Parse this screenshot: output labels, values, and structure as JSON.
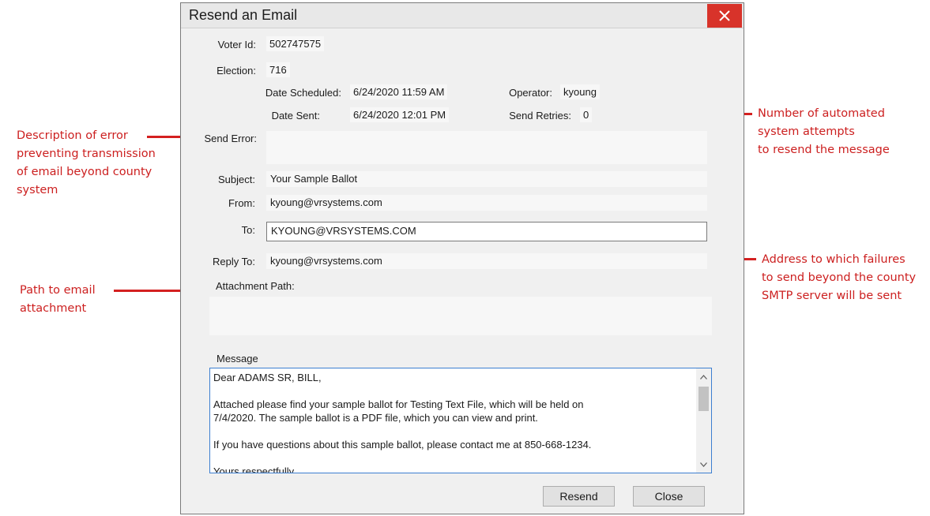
{
  "window": {
    "title": "Resend an Email"
  },
  "labels": {
    "voter_id": "Voter Id:",
    "election": "Election:",
    "date_scheduled": "Date Scheduled:",
    "operator": "Operator:",
    "date_sent": "Date Sent:",
    "send_retries": "Send Retries:",
    "send_error": "Send Error:",
    "subject": "Subject:",
    "from": "From:",
    "to": "To:",
    "reply_to": "Reply To:",
    "attachment_path": "Attachment Path:",
    "message": "Message"
  },
  "values": {
    "voter_id": "502747575",
    "election": "716",
    "date_scheduled": "6/24/2020 11:59 AM",
    "operator": "kyoung",
    "date_sent": "6/24/2020 12:01 PM",
    "send_retries": "0",
    "send_error": "",
    "subject": "Your Sample Ballot",
    "from": "kyoung@vrsystems.com",
    "to": "KYOUNG@VRSYSTEMS.COM",
    "reply_to": "kyoung@vrsystems.com",
    "attachment_path": "",
    "message": "Dear ADAMS SR, BILL,\n\nAttached please find your sample ballot for Testing Text File, which will be held on\n7/4/2020. The sample ballot is a PDF file, which you can view and print.\n\nIf you have questions about this sample ballot, please contact me at 850-668-1234.\n\nYours respectfully"
  },
  "buttons": {
    "resend": "Resend",
    "close": "Close"
  },
  "annotations": {
    "send_error": "Description of error\npreventing transmission\nof email beyond county\nsystem",
    "send_retries": "Number of automated\nsystem attempts\nto resend the message",
    "attachment": "Path to email\nattachment",
    "reply_to": "Address to which failures\nto send beyond the county\nSMTP server will be sent"
  },
  "colors": {
    "annotation": "#cc1f1f",
    "close_button": "#d8332a",
    "focus_border": "#3c7fd1"
  }
}
